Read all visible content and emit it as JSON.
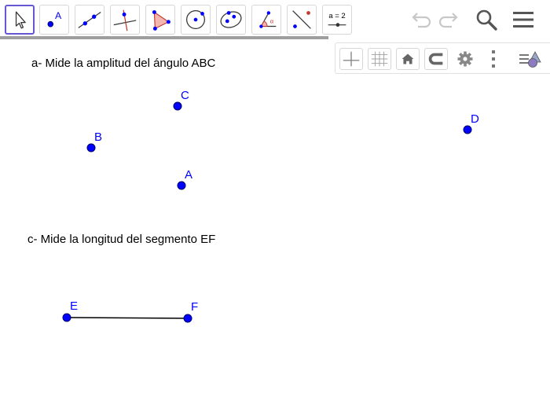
{
  "colors": {
    "point_fill": "#0000ff",
    "point_stroke": "#000066",
    "label": "#0000ff",
    "segment": "#000000",
    "selected_tool_border": "#6557d2",
    "icon_grey": "#555555"
  },
  "toolbar": {
    "tools": [
      {
        "icon": "move-arrow-icon"
      },
      {
        "icon": "point-icon",
        "label": "A"
      },
      {
        "icon": "line-icon"
      },
      {
        "icon": "perpendicular-line-icon"
      },
      {
        "icon": "polygon-icon"
      },
      {
        "icon": "circle-center-point-icon"
      },
      {
        "icon": "ellipse-icon"
      },
      {
        "icon": "angle-icon",
        "label": "α"
      },
      {
        "icon": "reflect-icon"
      },
      {
        "icon": "slider-icon",
        "label": "a = 2"
      }
    ],
    "right_icons": [
      "undo-icon",
      "redo-icon",
      "search-icon",
      "menu-icon"
    ]
  },
  "style_bar": {
    "icons": [
      "axes-icon",
      "grid-icon",
      "home-icon",
      "magnet-icon",
      "gear-icon",
      "more-vertical-icon",
      "style-bar-toggle-icon"
    ]
  },
  "texts": {
    "task_a": "a- Mide la amplitud del ángulo ABC",
    "task_c": "c- Mide la longitud del segmento EF"
  },
  "points": [
    {
      "name": "C",
      "label": "C"
    },
    {
      "name": "B",
      "label": "B"
    },
    {
      "name": "A",
      "label": "A"
    },
    {
      "name": "D",
      "label": "D"
    },
    {
      "name": "E",
      "label": "E"
    },
    {
      "name": "F",
      "label": "F"
    }
  ]
}
